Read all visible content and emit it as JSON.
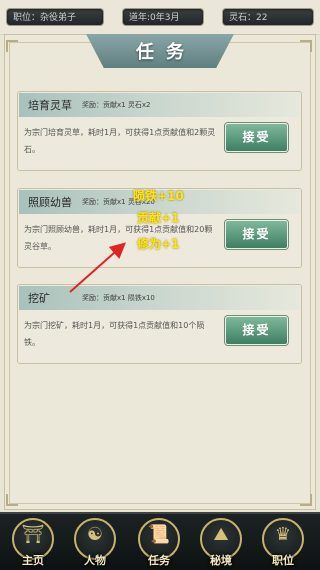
{
  "status": {
    "position": "职位：杂役弟子",
    "age": "道年:0年3月",
    "spirit_stone": "灵石：22"
  },
  "page_title": "任务",
  "tasks": [
    {
      "name": "培育灵草",
      "reward": "奖励：贡献x1 灵石x2",
      "desc": "为宗门培育灵草，耗时1月，可获得1点贡献值和2颗灵石。",
      "button": "接受"
    },
    {
      "name": "照顾幼兽",
      "reward": "奖励：贡献x1 灵谷x20",
      "desc": "为宗门照顾幼兽，耗时1月，可获得1点贡献值和20颗灵谷草。",
      "button": "接受"
    },
    {
      "name": "挖矿",
      "reward": "奖励：贡献x1 陨铁x10",
      "desc": "为宗门挖矿，耗时1月，可获得1点贡献值和10个陨铁。",
      "button": "接受"
    }
  ],
  "gains": [
    "陨铁+10",
    "贡献+1",
    "修为+1"
  ],
  "nav": [
    {
      "label": "主页",
      "icon": "pavilion-icon"
    },
    {
      "label": "人物",
      "icon": "character-icon"
    },
    {
      "label": "任务",
      "icon": "scroll-icon"
    },
    {
      "label": "秘境",
      "icon": "mountain-icon"
    },
    {
      "label": "职位",
      "icon": "rank-icon"
    }
  ],
  "colors": {
    "accent_gold": "#c9b36a",
    "button_green": "#3f7f62",
    "gain_yellow": "#ffe31a",
    "arrow_red": "#e02424"
  }
}
